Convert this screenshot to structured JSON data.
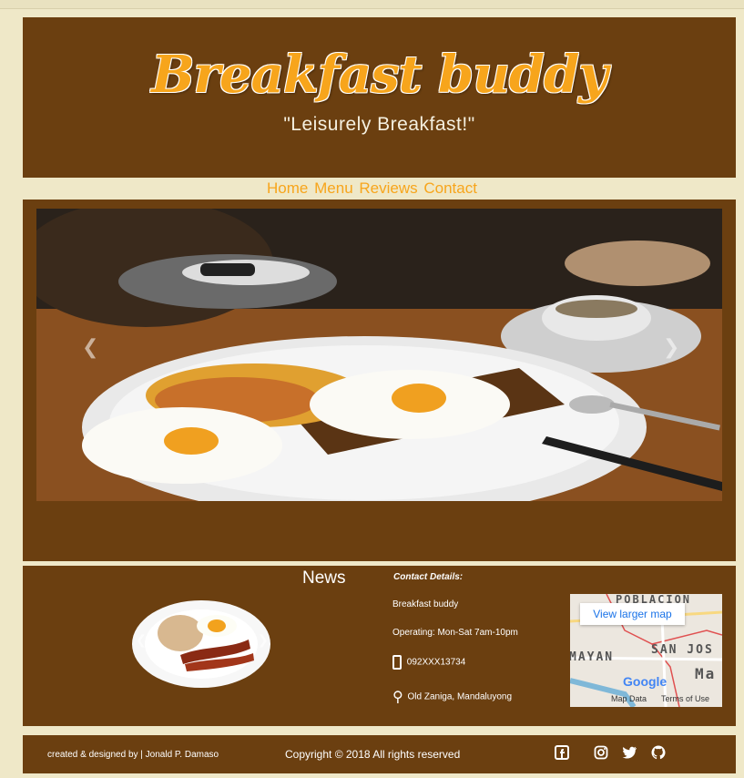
{
  "header": {
    "title": "Breakfast buddy",
    "tagline": "\"Leisurely Breakfast!\""
  },
  "nav": {
    "items": [
      "Home",
      "Menu",
      "Reviews",
      "Contact"
    ]
  },
  "hero": {
    "prev_label": "Previous",
    "next_label": "Next",
    "prev_icon": "chevron-left-icon",
    "next_icon": "chevron-right-icon"
  },
  "news": {
    "title": "News"
  },
  "contact": {
    "heading": "Contact Details:",
    "name": "Breakfast buddy",
    "hours": "Operating: Mon-Sat 7am-10pm",
    "phone": "092XXX13734",
    "address": "Old Zaniga, Mandaluyong"
  },
  "map": {
    "link_label": "View larger map",
    "labels": [
      "POBLACION",
      "MAYAN",
      "SAN JOS",
      "Ma"
    ],
    "google": "Google",
    "map_data": "Map Data",
    "terms": "Terms of Use"
  },
  "footer": {
    "credit": "created & designed by | Jonald P. Damaso",
    "copyright": "Copyright © 2018 All rights reserved",
    "social_icons": [
      "facebook-icon",
      "instagram-icon",
      "twitter-icon",
      "github-icon"
    ]
  },
  "colors": {
    "brown": "#6b3f10",
    "accent": "#f7a51c",
    "background": "#efe8c8"
  }
}
